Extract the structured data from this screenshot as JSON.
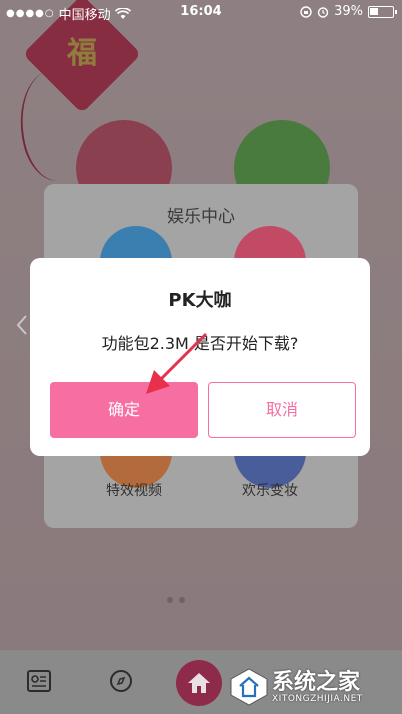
{
  "status_bar": {
    "carrier": "中国移动",
    "time": "16:04",
    "battery_percent": "39%",
    "battery_level": 0.39,
    "signal_icon": "signal-dots-icon",
    "wifi_icon": "wifi-icon",
    "lock_icon": "rotation-lock-icon",
    "alarm_icon": "alarm-clock-icon"
  },
  "background": {
    "kite_char": "福"
  },
  "panel": {
    "title": "娱乐中心",
    "items": [
      {
        "label": "特效视频"
      },
      {
        "label": "欢乐变妆"
      }
    ]
  },
  "dialog": {
    "title": "PK大咖",
    "message": "功能包2.3M,是否开始下载?",
    "confirm_label": "确定",
    "cancel_label": "取消",
    "accent_color": "#f76ea3"
  },
  "bottom_nav": {
    "icons": [
      "profile-card-icon",
      "compass-icon",
      "home-icon"
    ]
  },
  "watermark": {
    "title": "系统之家",
    "subtitle": "XITONGZHIJIA.NET"
  }
}
